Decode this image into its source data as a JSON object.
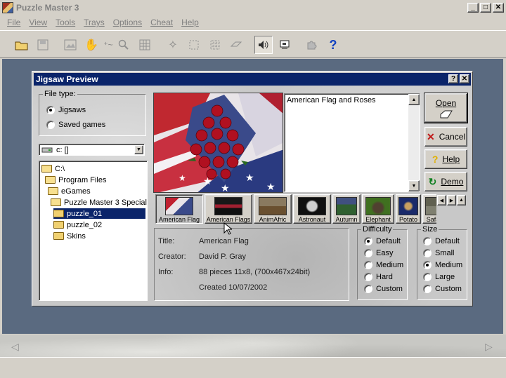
{
  "app": {
    "title": "Puzzle Master 3"
  },
  "window_buttons": {
    "minimize": "_",
    "maximize": "□",
    "close": "✕"
  },
  "menu": [
    "File",
    "View",
    "Tools",
    "Trays",
    "Options",
    "Cheat",
    "Help"
  ],
  "toolbar": {
    "help_label": "?"
  },
  "dialog": {
    "title": "Jigsaw Preview",
    "help_btn": "?",
    "close_btn": "✕",
    "file_type": {
      "legend": "File type:",
      "options": [
        "Jigsaws",
        "Saved games"
      ],
      "selected": "Jigsaws"
    },
    "drive": {
      "value": "c: []"
    },
    "tree": [
      {
        "label": "C:\\",
        "level": 0
      },
      {
        "label": "Program Files",
        "level": 1
      },
      {
        "label": "eGames",
        "level": 2
      },
      {
        "label": "Puzzle Master 3 Special",
        "level": 3
      },
      {
        "label": "puzzle_01",
        "level": 4,
        "selected": true
      },
      {
        "label": "puzzle_02",
        "level": 4
      },
      {
        "label": "Skins",
        "level": 4
      }
    ],
    "description": "American Flag and Roses",
    "buttons": {
      "open": "Open",
      "cancel": "Cancel",
      "help": "Help",
      "demo": "Demo"
    },
    "thumbnails": [
      "American Flag",
      "American Flags",
      "AnimAfric",
      "Astronaut",
      "Autumn",
      "Elephant",
      "Potato",
      "Safa"
    ],
    "selected_thumbnail": "American Flag",
    "info": {
      "title_label": "Title:",
      "title_value": "American Flag",
      "creator_label": "Creator:",
      "creator_value": "David P. Gray",
      "info_label": "Info:",
      "info_value": "88 pieces 11x8, (700x467x24bit)",
      "created": "Created 10/07/2002"
    },
    "difficulty": {
      "legend": "Difficulty",
      "options": [
        "Default",
        "Easy",
        "Medium",
        "Hard",
        "Custom"
      ],
      "selected": "Default"
    },
    "size": {
      "legend": "Size",
      "options": [
        "Default",
        "Small",
        "Medium",
        "Large",
        "Custom"
      ],
      "selected": "Medium"
    }
  },
  "colors": {
    "title_active": "#0a246a",
    "workspace": "#5a6a80",
    "face": "#d4d0c8"
  }
}
